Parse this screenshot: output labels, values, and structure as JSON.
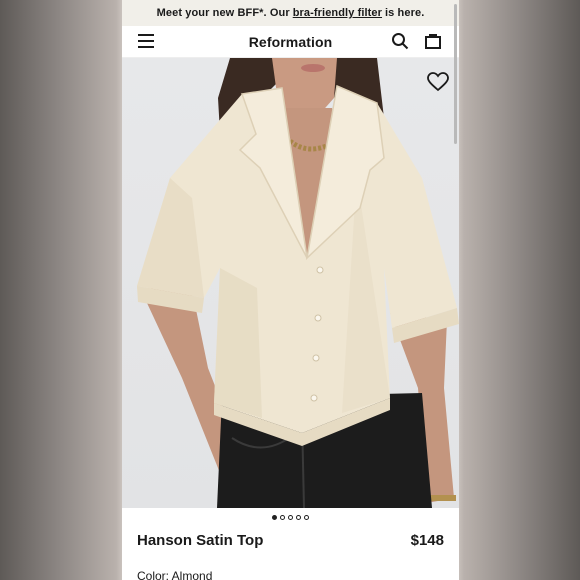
{
  "promo": {
    "text": "Meet your new BFF*. Our",
    "link": "bra-friendly filter",
    "suffix": "is here."
  },
  "header": {
    "brand": "Reformation",
    "icons": [
      "menu-icon",
      "search-icon",
      "bag-icon"
    ]
  },
  "gallery": {
    "total_images": 5,
    "active_index": 1,
    "wishlist_icon": "heart-icon"
  },
  "product": {
    "name": "Hanson Satin Top",
    "price": "$148",
    "color_label": "Color: Almond"
  },
  "colors": {
    "promo_bg": "#f1efe9",
    "text": "#1a1a1a",
    "photo_bg": "#e4e5e7",
    "satin": "#efe6d2"
  }
}
